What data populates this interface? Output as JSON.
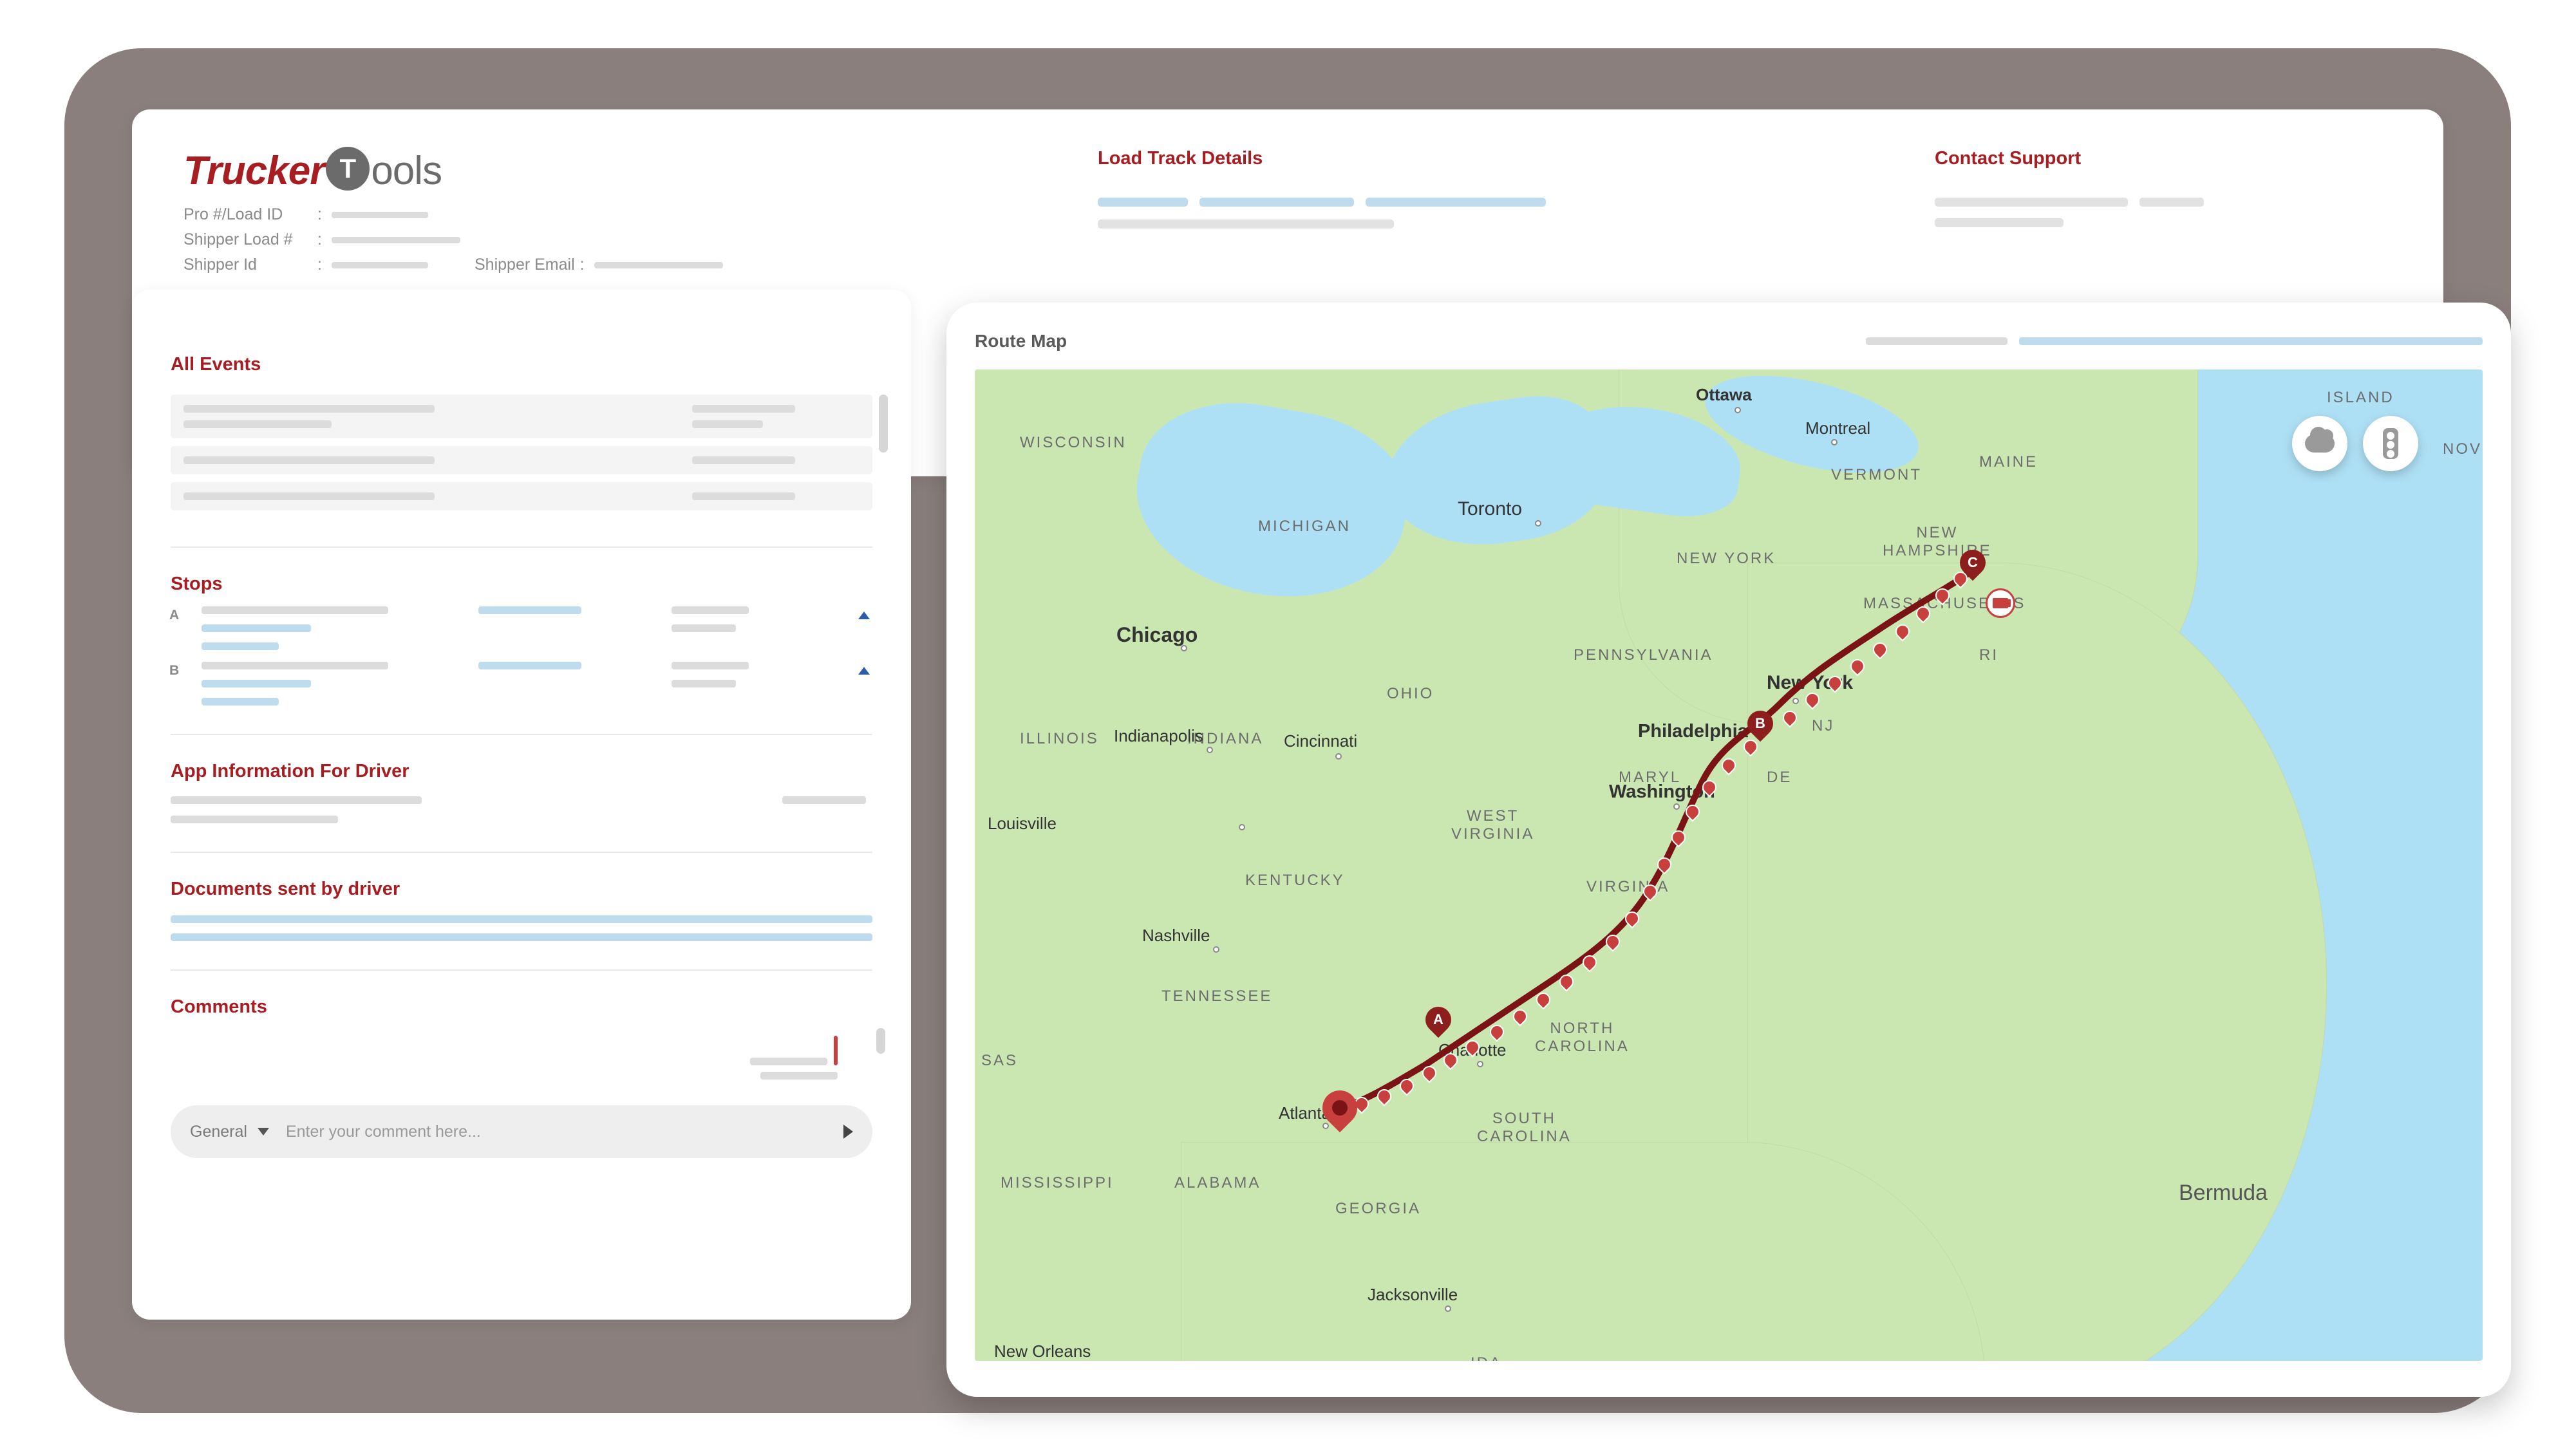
{
  "logo": {
    "part1": "Trucker",
    "badge": "T",
    "part2": "ools"
  },
  "meta": {
    "pro_load_id_label": "Pro #/Load ID",
    "shipper_load_label": "Shipper Load #",
    "shipper_id_label": "Shipper Id",
    "shipper_email_label": "Shipper Email",
    "colon": ":"
  },
  "load_track_details_title": "Load Track Details",
  "contact_support_title": "Contact Support",
  "sections": {
    "all_events": "All Events",
    "stops": "Stops",
    "app_info": "App Information For Driver",
    "documents": "Documents sent by driver",
    "comments": "Comments"
  },
  "stops": [
    {
      "letter": "A"
    },
    {
      "letter": "B"
    }
  ],
  "comment_input": {
    "select_label": "General",
    "placeholder": "Enter your comment here..."
  },
  "map": {
    "title": "Route Map",
    "stop_pins": [
      "A",
      "B",
      "C"
    ],
    "labels": {
      "ottawa": "Ottawa",
      "montreal": "Montreal",
      "toronto": "Toronto",
      "chicago": "Chicago",
      "newyork": "New York",
      "philadelphia": "Philadelphia",
      "washington": "Washington",
      "indianapolis": "Indianapolis",
      "cincinnati": "Cincinnati",
      "louisville": "Louisville",
      "nashville": "Nashville",
      "charlotte": "Charlotte",
      "atlanta": "Atlanta",
      "jacksonville": "Jacksonville",
      "neworleans": "New Orleans",
      "bermuda": "Bermuda",
      "wisconsin": "WISCONSIN",
      "michigan": "MICHIGAN",
      "illinois": "ILLINOIS",
      "indiana": "INDIANA",
      "ohio": "OHIO",
      "pennsylvania": "PENNSYLVANIA",
      "newyork_s": "NEW YORK",
      "vermont": "VERMONT",
      "newhampshire": "NEW\nHAMPSHIRE",
      "massachusetts": "MASSACHUSETTS",
      "ri": "RI",
      "maryl": "MARYL",
      "de": "DE",
      "nj": "NJ",
      "westvirginia": "WEST\nVIRGINIA",
      "virginia": "VIRGINIA",
      "kentucky": "KENTUCKY",
      "tennessee": "TENNESSEE",
      "northcarolina": "NORTH\nCAROLINA",
      "southcarolina": "SOUTH\nCAROLINA",
      "georgia": "GEORGIA",
      "alabama": "ALABAMA",
      "mississippi": "MISSISSIPPI",
      "sas": "SAS",
      "ida": "IDA",
      "maine": "MAINE",
      "island": "ISLAND",
      "nov": "NOV"
    }
  }
}
